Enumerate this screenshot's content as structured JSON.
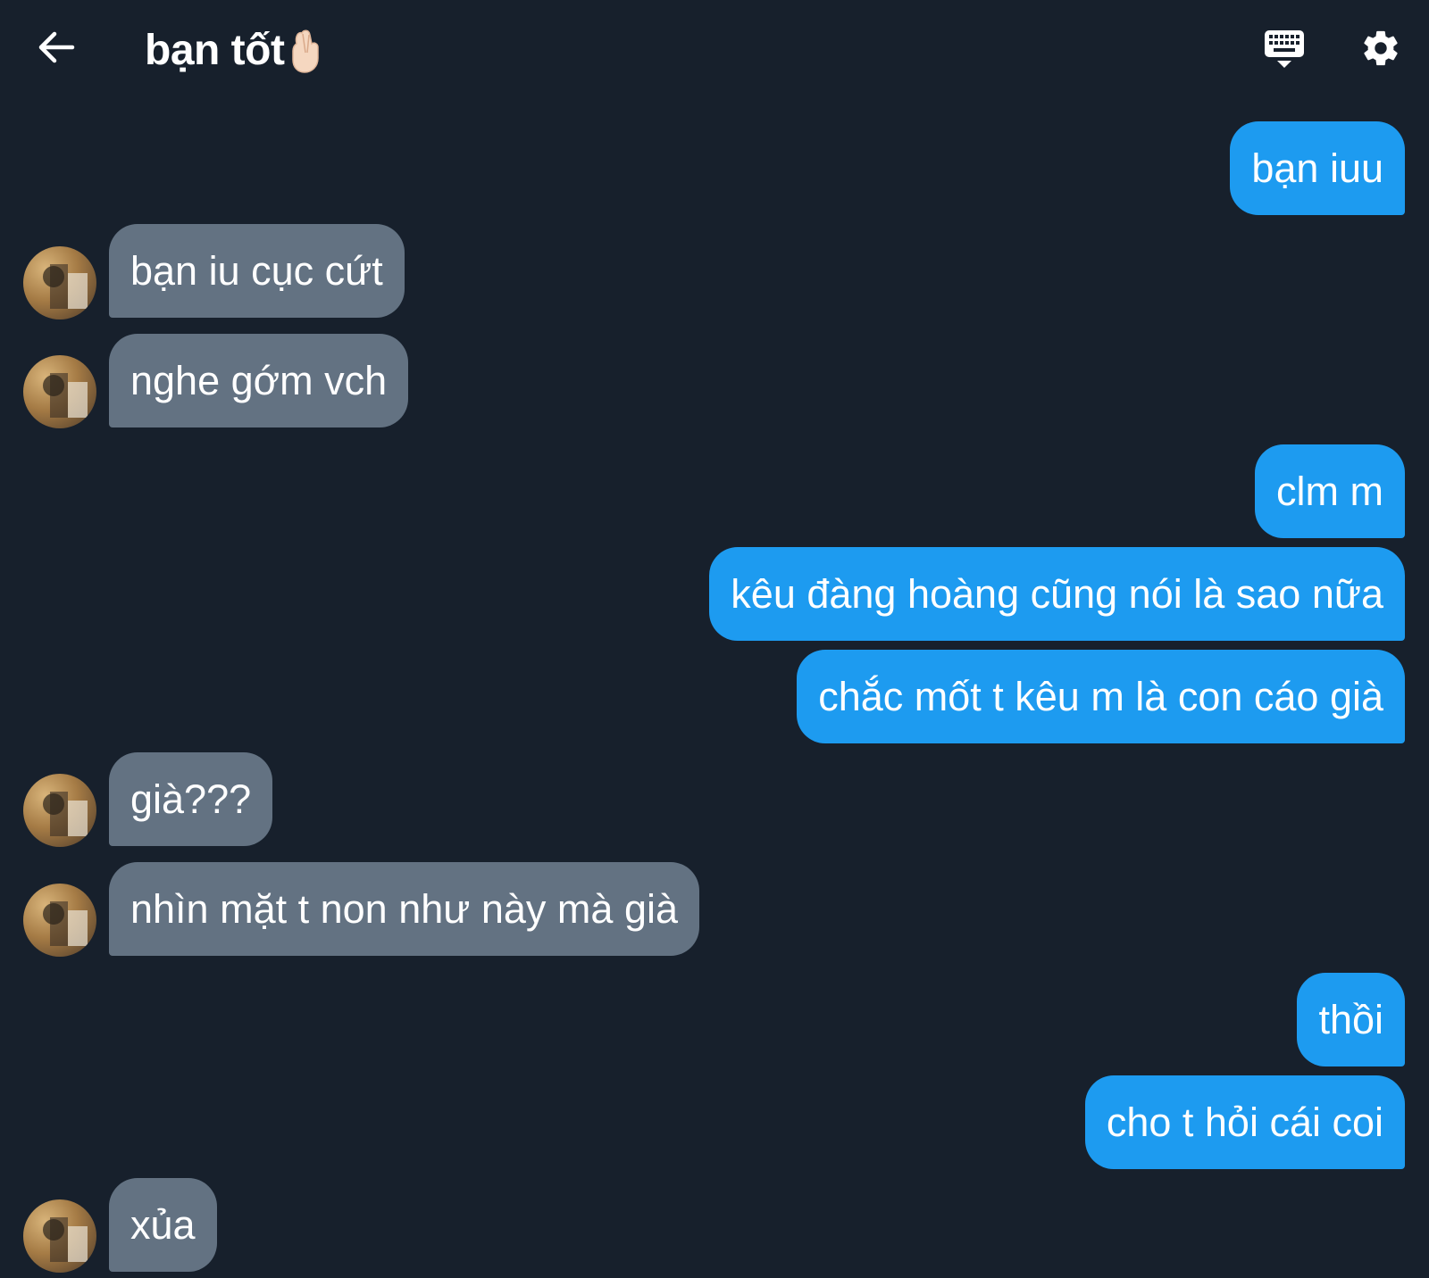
{
  "header": {
    "title": "bạn tốt",
    "title_emoji": "hand-crossed-fingers",
    "back_icon": "back-arrow-icon",
    "keyboard_icon": "keyboard-icon",
    "settings_icon": "gear-icon"
  },
  "colors": {
    "background": "#17202c",
    "outgoing_bubble": "#1d9bf0",
    "incoming_bubble": "#637282",
    "text": "#ffffff"
  },
  "messages": [
    {
      "direction": "out",
      "text": "bạn iuu"
    },
    {
      "direction": "in",
      "text": "bạn iu cục cứt"
    },
    {
      "direction": "in",
      "text": "nghe gớm vch"
    },
    {
      "direction": "out",
      "text": "clm m"
    },
    {
      "direction": "out",
      "text": "kêu đàng hoàng cũng nói là sao nữa"
    },
    {
      "direction": "out",
      "text": "chắc mốt t kêu m là con cáo già"
    },
    {
      "direction": "in",
      "text": "già???"
    },
    {
      "direction": "in",
      "text": "nhìn mặt t non như này mà già"
    },
    {
      "direction": "out",
      "text": "thồi"
    },
    {
      "direction": "out",
      "text": "cho t hỏi cái coi"
    },
    {
      "direction": "in",
      "text": "xủa"
    }
  ]
}
